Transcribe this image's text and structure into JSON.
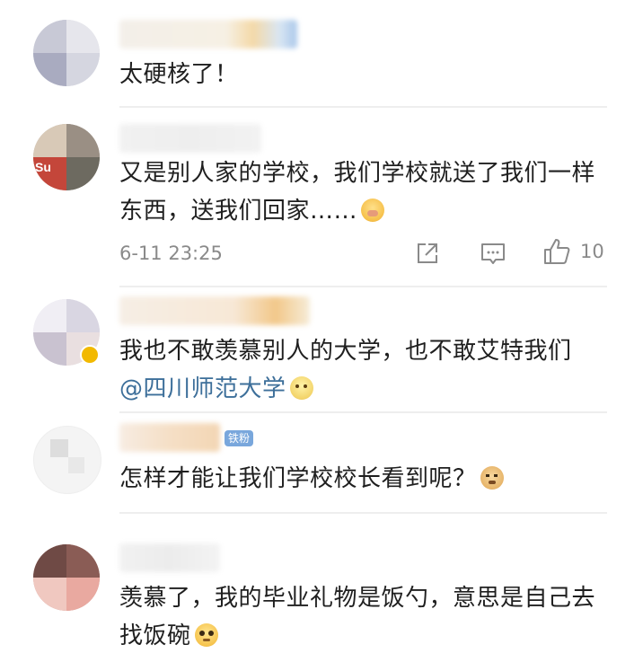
{
  "comments": [
    {
      "text": "太硬核了！"
    },
    {
      "text": "又是别人家的学校，我们学校就送了我们一样东西，送我们回家……",
      "timestamp": "6-11 23:25",
      "like_count": "10",
      "avatar_badge_text": "Su"
    },
    {
      "text_line1": "我也不敢羡慕别人的大学，也不敢艾特我们",
      "mention": "@四川师范大学"
    },
    {
      "badge": "铁粉",
      "text": "怎样才能让我们学校校长看到呢？"
    },
    {
      "text": "羡慕了，我的毕业礼物是饭勺，意思是自己去找饭碗"
    }
  ],
  "icons": {
    "share": "share-icon",
    "comment": "comment-icon",
    "like": "thumbs-up-icon"
  },
  "colors": {
    "mention": "#3d6f9a",
    "badge": "#79a7dc",
    "meta": "#8a8a8a"
  }
}
